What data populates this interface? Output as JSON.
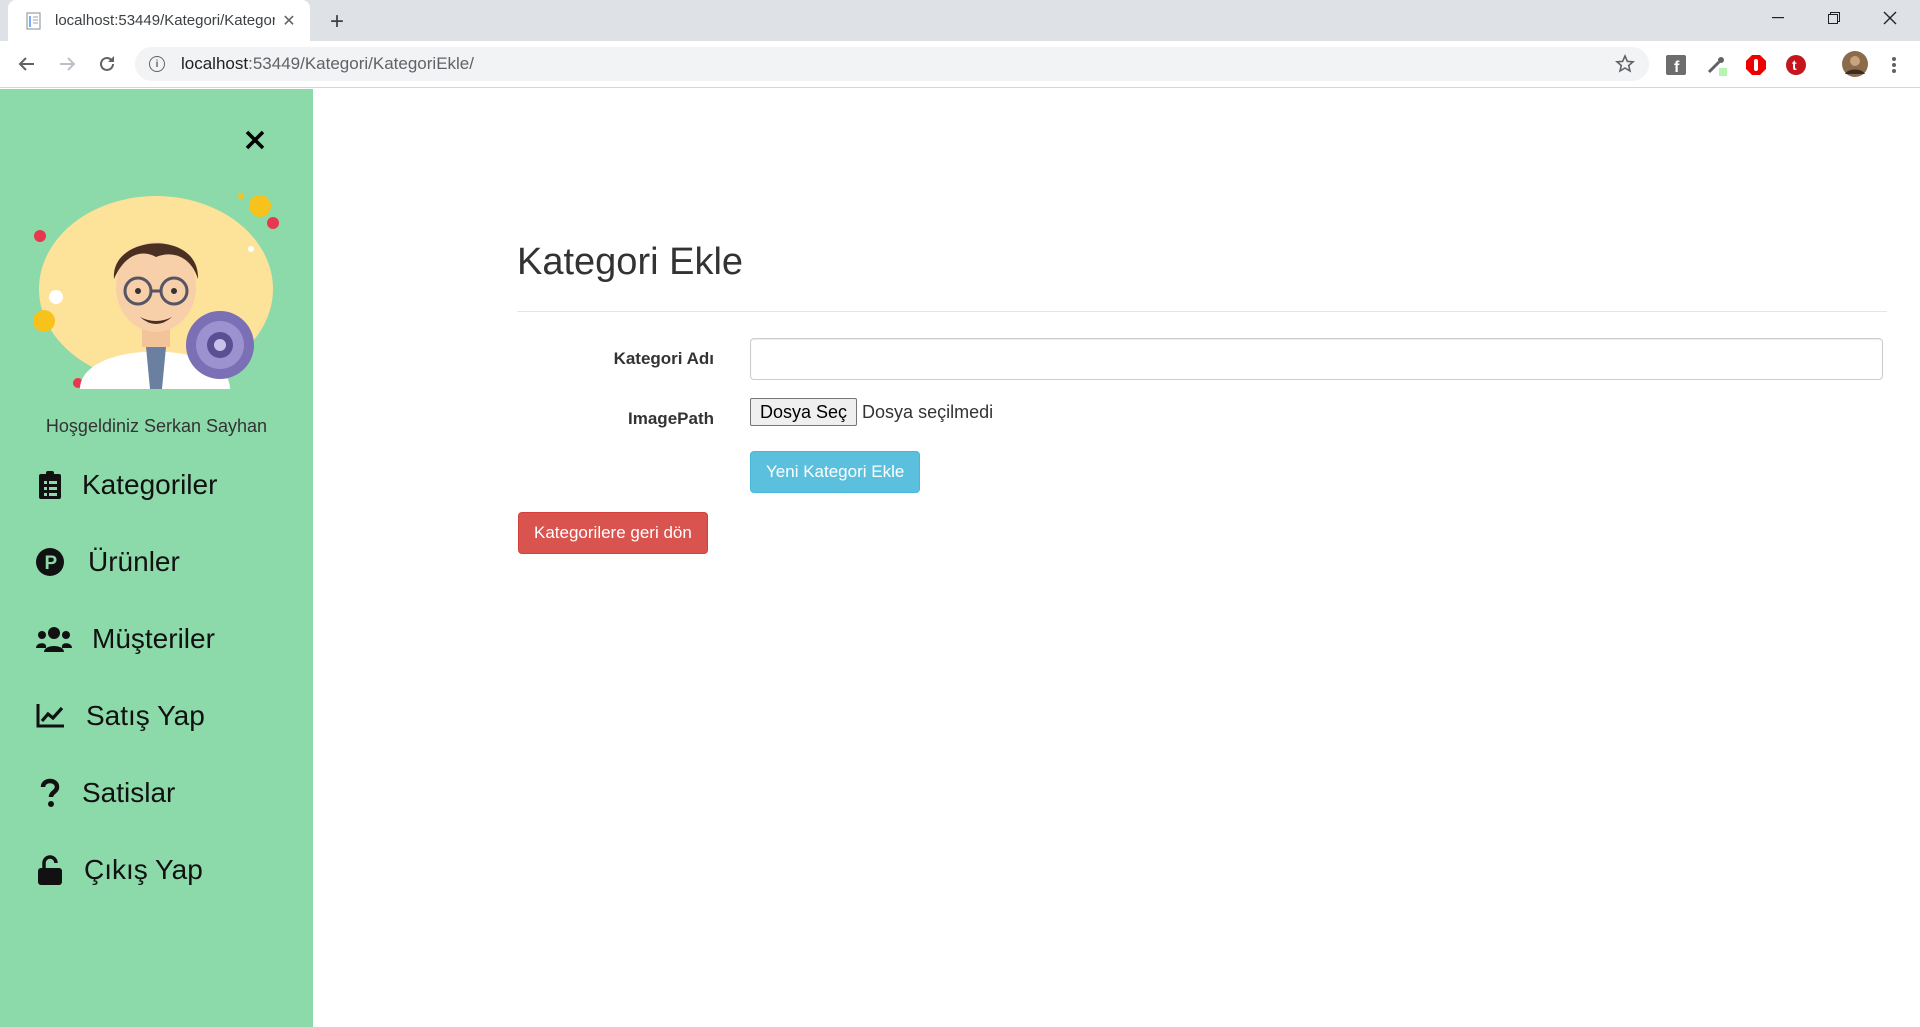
{
  "browser": {
    "tab_title": "localhost:53449/Kategori/KategoriEkle/",
    "url_host": "localhost",
    "url_rest": ":53449/Kategori/KategoriEkle/"
  },
  "sidebar": {
    "welcome": "Hoşgeldiniz Serkan Sayhan",
    "items": [
      {
        "label": "Kategoriler",
        "icon": "clipboard-list-icon"
      },
      {
        "label": "Ürünler",
        "icon": "parking-circle-icon"
      },
      {
        "label": "Müşteriler",
        "icon": "users-icon"
      },
      {
        "label": "Satış Yap",
        "icon": "chart-line-icon"
      },
      {
        "label": "Satislar",
        "icon": "question-icon"
      },
      {
        "label": "Çıkış Yap",
        "icon": "unlock-icon"
      }
    ],
    "bg_color": "#8cd9aa"
  },
  "main": {
    "title": "Kategori Ekle",
    "form": {
      "name_label": "Kategori Adı",
      "name_value": "",
      "image_label": "ImagePath",
      "file_button": "Dosya Seç",
      "file_status": "Dosya seçilmedi",
      "submit_label": "Yeni Kategori Ekle"
    },
    "back_label": "Kategorilere geri dön"
  },
  "colors": {
    "info": "#5bc0de",
    "danger": "#d9534f"
  }
}
